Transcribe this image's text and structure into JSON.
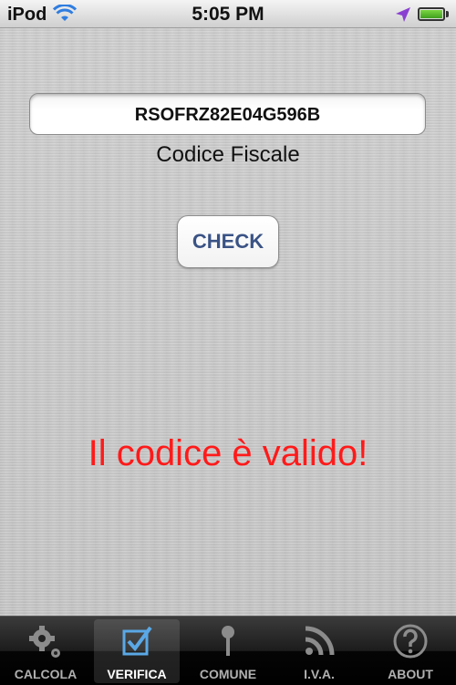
{
  "status_bar": {
    "carrier": "iPod",
    "time": "5:05 PM",
    "icons": [
      "wifi-icon",
      "location-arrow-icon",
      "battery-icon"
    ]
  },
  "verify": {
    "code_value": "RSOFRZ82E04G596B",
    "code_label": "Codice Fiscale",
    "check_label": "CHECK",
    "result_text": "Il codice è valido!",
    "result_color": "#ff1a1a"
  },
  "tabs": [
    {
      "label": "CALCOLA",
      "icon": "gears-icon",
      "active": false
    },
    {
      "label": "VERIFICA",
      "icon": "checkbox-icon",
      "active": true
    },
    {
      "label": "COMUNE",
      "icon": "pin-icon",
      "active": false
    },
    {
      "label": "I.V.A.",
      "icon": "rss-icon",
      "active": false
    },
    {
      "label": "ABOUT",
      "icon": "question-icon",
      "active": false
    }
  ],
  "colors": {
    "accent_tab": "#5aa8e6",
    "check_text": "#3a5385"
  }
}
